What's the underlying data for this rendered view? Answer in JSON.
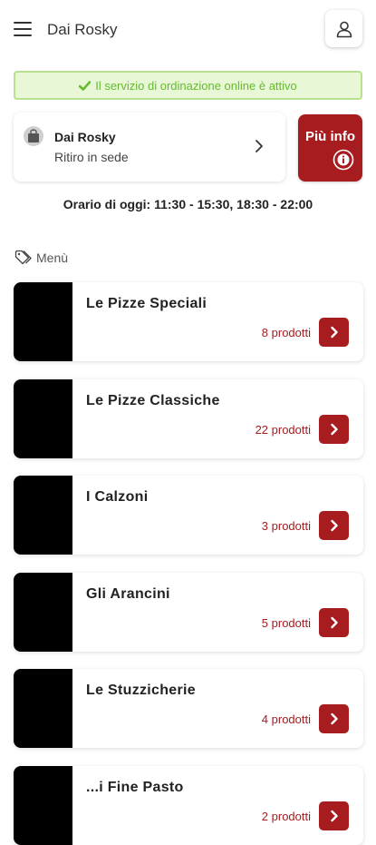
{
  "header": {
    "title": "Dai Rosky",
    "menu_icon": "hamburger-icon",
    "user_icon": "user-icon"
  },
  "status_banner": {
    "text": "Il servizio di ordinazione online è attivo",
    "icon": "check-icon",
    "color": "#66bb2e",
    "background": "#e8f7d6"
  },
  "store": {
    "name": "Dai Rosky",
    "mode": "Ritiro in sede",
    "icon": "bag-icon"
  },
  "info_button": {
    "label": "Più info",
    "icon": "info-icon"
  },
  "hours": "Orario di oggi: 11:30 - 15:30, 18:30 - 22:00",
  "menu_section": {
    "label": "Menù",
    "icon": "tag-icon"
  },
  "categories": [
    {
      "name": "Le Pizze Speciali",
      "count": "8 prodotti"
    },
    {
      "name": "Le Pizze Classiche",
      "count": "22 prodotti"
    },
    {
      "name": "I Calzoni",
      "count": "3 prodotti"
    },
    {
      "name": "Gli Arancini",
      "count": "5 prodotti"
    },
    {
      "name": "Le Stuzzicherie",
      "count": "4 prodotti"
    },
    {
      "name": "...i Fine Pasto",
      "count": "2 prodotti"
    }
  ],
  "colors": {
    "accent": "#a61c1f",
    "category_image": "#000000"
  }
}
